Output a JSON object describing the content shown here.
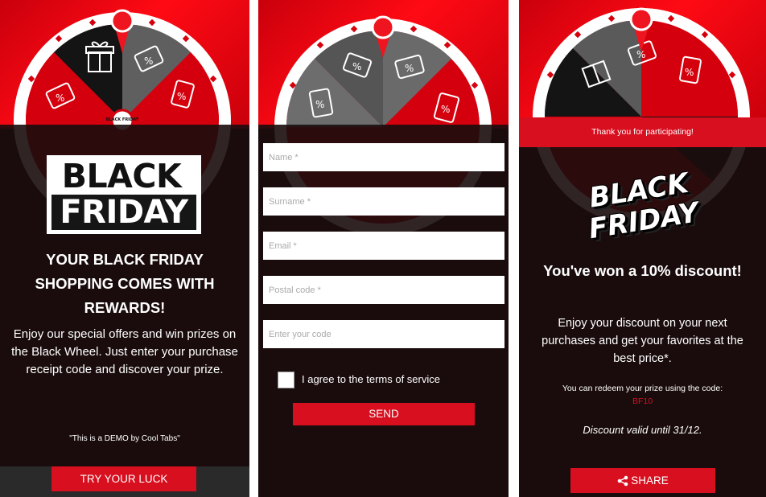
{
  "panel1": {
    "logo_line1": "BLACK",
    "logo_line2": "FRIDAY",
    "headline": "YOUR BLACK FRIDAY SHOPPING COMES WITH REWARDS!",
    "description": "Enjoy our special offers and win prizes on the Black Wheel. Just enter your purchase receipt code and discover your prize.",
    "demo_note": "\"This is a DEMO by Cool Tabs\"",
    "cta_label": "TRY YOUR LUCK",
    "wheel_center_label": "BLACK FRIDAY"
  },
  "panel2": {
    "fields": {
      "name_placeholder": "Name *",
      "surname_placeholder": "Surname *",
      "email_placeholder": "Email *",
      "postal_placeholder": "Postal code *",
      "code_placeholder": "Enter your code"
    },
    "terms_label": "I agree to the terms of service",
    "terms_checked": false,
    "send_label": "SEND"
  },
  "panel3": {
    "thanks": "Thank you for participating!",
    "logo_line1": "BLACK",
    "logo_line2": "FRIDAY",
    "won_title": "You've won a 10% discount!",
    "enjoy_text": "Enjoy your discount on your next purchases and get your favorites at the best price*.",
    "redeem_text": "You can redeem your prize using the code:",
    "code": "BF10",
    "valid_text": "Discount valid until 31/12.",
    "share_label": "SHARE"
  },
  "colors": {
    "brand_red": "#d70f1f",
    "dark_bg": "#1f0f10",
    "wheel_dark": "#1a1a1a",
    "wheel_grey": "#6a6a6a"
  },
  "icons": [
    "gift-icon",
    "discount-tag-icon",
    "pointer-pin-icon",
    "share-icon"
  ]
}
